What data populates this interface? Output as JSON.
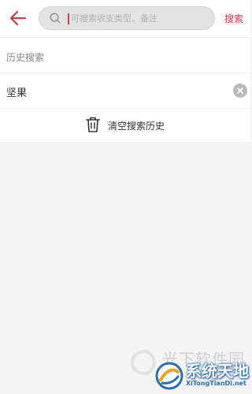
{
  "colors": {
    "accent": "#d2374a",
    "background": "#f4f4f4",
    "surface": "#ffffff",
    "search_bg": "#e3e3e3"
  },
  "header": {
    "back_icon": "arrow-left-icon",
    "search": {
      "icon": "search-icon",
      "placeholder": "可搜索收支类型、备注",
      "value": ""
    },
    "search_button_label": "搜索"
  },
  "history": {
    "title": "历史搜索",
    "items": [
      {
        "label": "坚果",
        "clear_icon": "close-circle-icon"
      }
    ],
    "clear_all_label": "清空搜索历史",
    "clear_all_icon": "trash-icon"
  },
  "watermark": {
    "faded_text": "光下软件园",
    "name": "系统天地",
    "url": "XiTongTianDi.net"
  }
}
